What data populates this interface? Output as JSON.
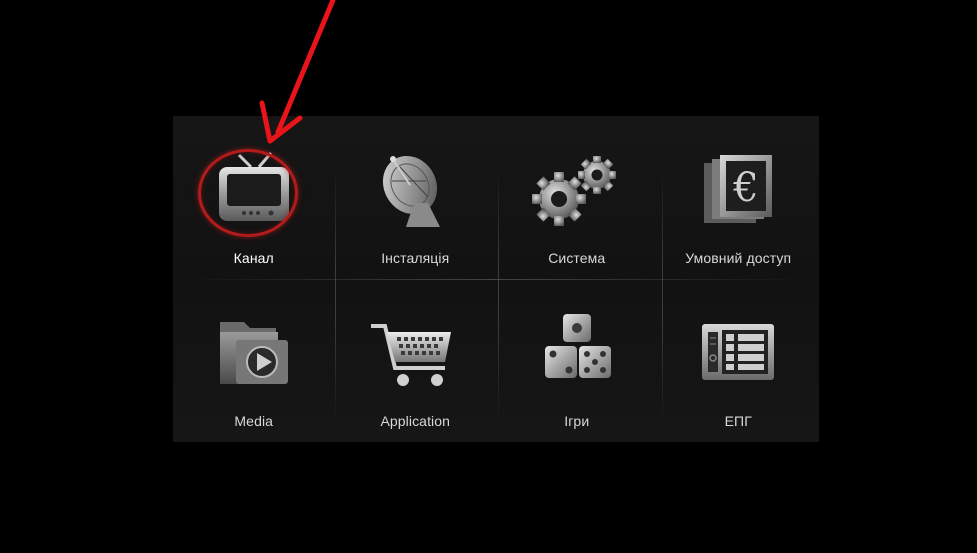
{
  "menu": {
    "items": [
      {
        "label": "Канал",
        "icon": "tv-icon",
        "selected": true
      },
      {
        "label": "Інсталяція",
        "icon": "satellite-dish-icon",
        "selected": false
      },
      {
        "label": "Система",
        "icon": "gears-icon",
        "selected": false
      },
      {
        "label": "Умовний доступ",
        "icon": "euro-card-icon",
        "selected": false
      },
      {
        "label": "Media",
        "icon": "media-folder-icon",
        "selected": false
      },
      {
        "label": "Application",
        "icon": "shopping-cart-icon",
        "selected": false
      },
      {
        "label": "Ігри",
        "icon": "dice-icon",
        "selected": false
      },
      {
        "label": "ЕПГ",
        "icon": "epg-guide-icon",
        "selected": false
      }
    ]
  },
  "annotation": {
    "arrow": "red-arrow-icon",
    "ring": "highlight-ring",
    "color": "#e8141a"
  },
  "colors": {
    "background": "#000000",
    "panel": "#141414",
    "label": "#d8d8d8",
    "highlight": "#b31b1b"
  }
}
